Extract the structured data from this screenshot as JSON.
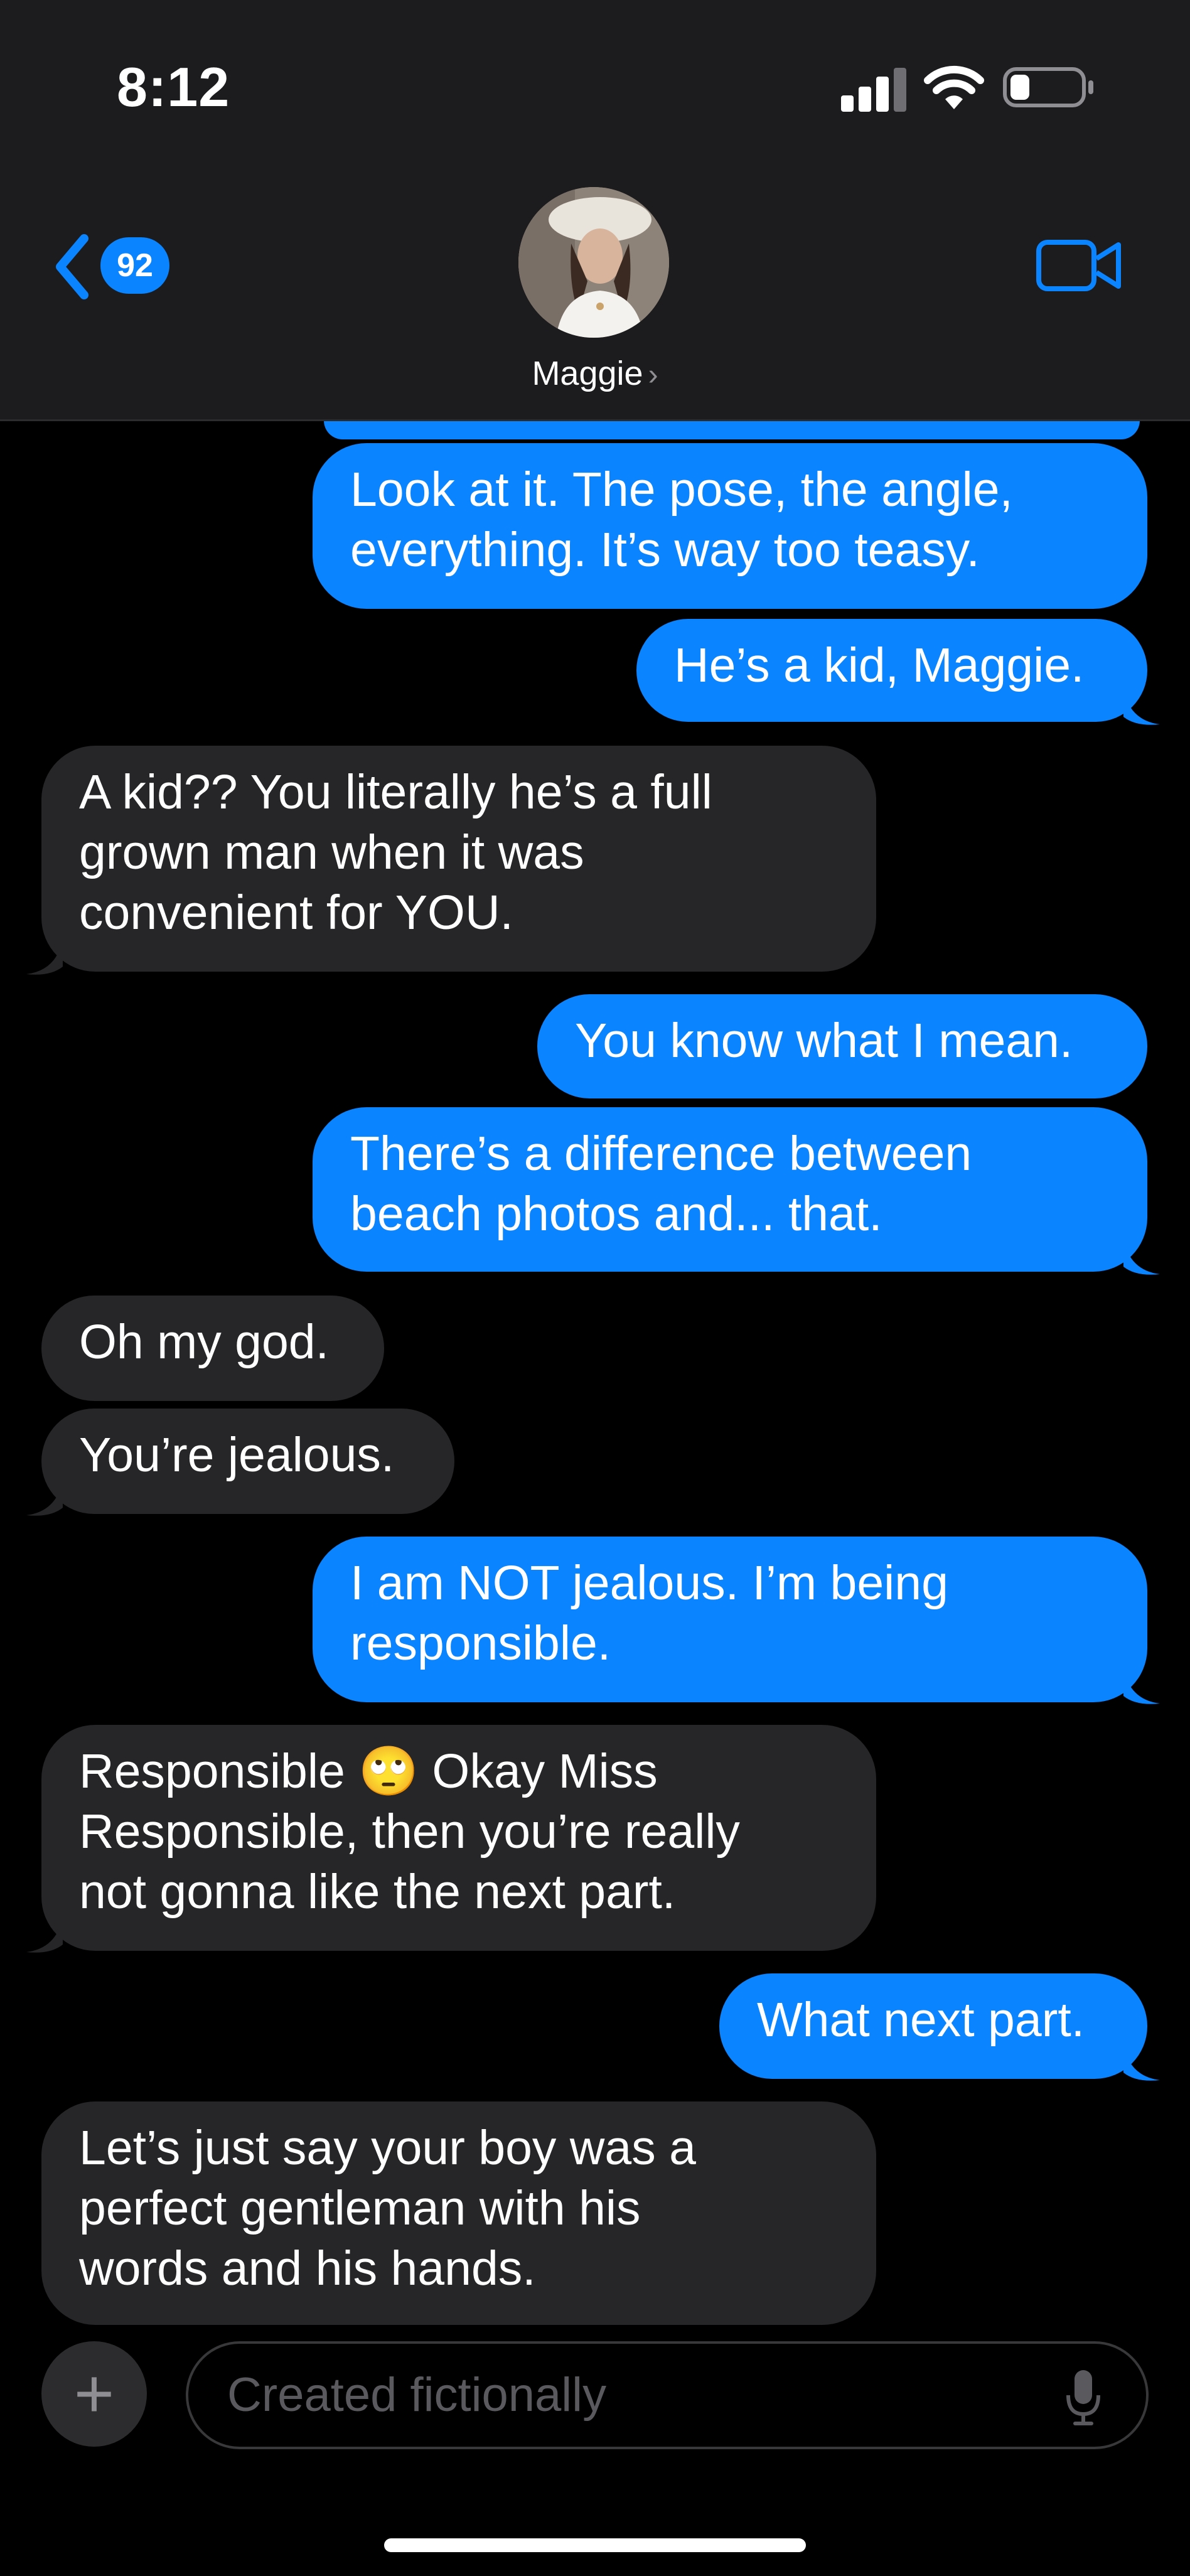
{
  "status_bar": {
    "time": "8:12"
  },
  "header": {
    "back_badge": "92",
    "contact_name": "Maggie",
    "name_chevron": "›"
  },
  "messages": [
    {
      "from": "me",
      "text": "Look at it. The pose, the angle,\neverything. It’s way too teasy."
    },
    {
      "from": "me",
      "text": "He’s a kid, Maggie."
    },
    {
      "from": "them",
      "text": "A kid?? You literally he’s a full\ngrown man when it was\nconvenient for YOU."
    },
    {
      "from": "me",
      "text": "You know what I mean."
    },
    {
      "from": "me",
      "text": "There’s a difference between\nbeach photos and... that."
    },
    {
      "from": "them",
      "text": "Oh my god."
    },
    {
      "from": "them",
      "text": "You’re jealous."
    },
    {
      "from": "me",
      "text": "I am NOT jealous. I’m being\nresponsible."
    },
    {
      "from": "them",
      "text": "Responsible 🙄 Okay Miss\nResponsible, then you’re really\nnot gonna like the next part."
    },
    {
      "from": "me",
      "text": "What next part."
    },
    {
      "from": "them",
      "text": "Let’s just say your boy was a\nperfect gentleman with his\nwords and his hands."
    }
  ],
  "composer": {
    "plus_label": "+",
    "placeholder": "Created fictionally"
  },
  "colors": {
    "sent_bubble": "#0a84ff",
    "received_bubble": "#262628",
    "header_bg": "#1c1c1e",
    "background": "#000000"
  },
  "icons": [
    "back-chevron-icon",
    "video-call-icon",
    "microphone-icon",
    "plus-icon",
    "signal-icon",
    "wifi-icon",
    "battery-icon"
  ]
}
